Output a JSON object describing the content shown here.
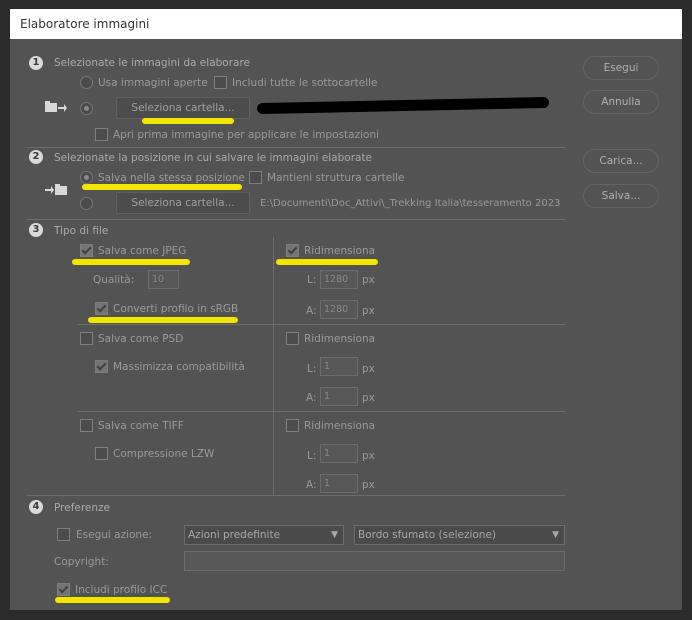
{
  "window": {
    "title": "Elaboratore immagini"
  },
  "section1": {
    "number": "1",
    "heading": "Selezionate le immagini da elaborare",
    "use_open": "Usa immagini aperte",
    "include_subfolders": "Includi tutte le sottocartelle",
    "select_folder": "Seleziona cartella...",
    "open_first": "Apri prima immagine per applicare le impostazioni"
  },
  "section2": {
    "number": "2",
    "heading": "Selezionate la posizione in cui salvare le immagini elaborate",
    "same_location": "Salva nella stessa posizione",
    "keep_structure": "Mantieni struttura cartelle",
    "select_folder": "Seleziona cartella...",
    "path": "E:\\Documenti\\Doc_Attivi\\_Trekking Italia\\tesseramento 2023"
  },
  "section3": {
    "number": "3",
    "heading": "Tipo di file",
    "jpeg": {
      "save": "Salva come JPEG",
      "quality_label": "Qualità:",
      "quality_value": "10",
      "resize": "Ridimensiona",
      "w_label": "L:",
      "w_value": "1280",
      "h_label": "A:",
      "h_value": "1280",
      "unit": "px",
      "convert_srgb": "Converti profilo in sRGB"
    },
    "psd": {
      "save": "Salva come PSD",
      "resize": "Ridimensiona",
      "maximize": "Massimizza compatibilità",
      "w_label": "L:",
      "w_value": "1",
      "h_label": "A:",
      "h_value": "1",
      "unit": "px"
    },
    "tiff": {
      "save": "Salva come TIFF",
      "resize": "Ridimensiona",
      "lzw": "Compressione LZW",
      "w_label": "L:",
      "w_value": "1",
      "h_label": "A:",
      "h_value": "1",
      "unit": "px"
    }
  },
  "section4": {
    "number": "4",
    "heading": "Preferenze",
    "run_action": "Esegui azione:",
    "action_set": "Azioni predefinite",
    "action": "Bordo sfumato (selezione)",
    "copyright_label": "Copyright:",
    "copyright_value": "",
    "include_icc": "Includi profilo ICC"
  },
  "buttons": {
    "run": "Esegui",
    "cancel": "Annulla",
    "load": "Carica...",
    "save": "Salva..."
  },
  "colors": {
    "highlight": "#f2e600",
    "dialog_bg": "#535353",
    "outer_bg": "#2b2b2b"
  }
}
